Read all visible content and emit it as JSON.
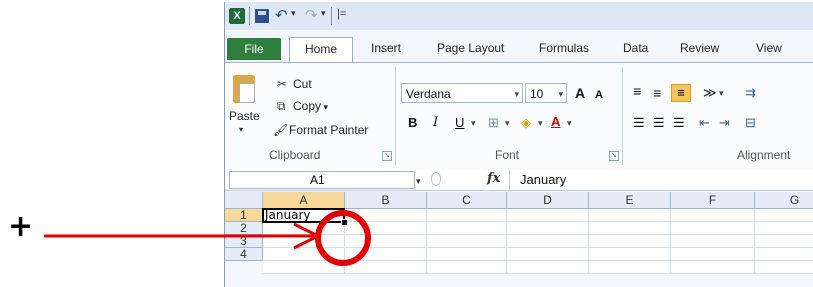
{
  "annotation": {
    "plus": "+",
    "arrow_color": "#e00000"
  },
  "qat": {
    "app_icon": "X",
    "undo_icon": "undo-icon",
    "redo_icon": "redo-icon",
    "more": "|="
  },
  "tabs": [
    "File",
    "Home",
    "Insert",
    "Page Layout",
    "Formulas",
    "Data",
    "Review",
    "View"
  ],
  "clipboard": {
    "paste": "Paste",
    "cut": "Cut",
    "copy": "Copy",
    "format_painter": "Format Painter",
    "label": "Clipboard"
  },
  "font": {
    "name": "Verdana",
    "size": "10",
    "label": "Font",
    "bold": "B",
    "italic": "I",
    "underline": "U",
    "grow": "A",
    "shrink": "A"
  },
  "alignment": {
    "label": "Alignment"
  },
  "formula_bar": {
    "name_box": "A1",
    "fx": "fx",
    "value": "January"
  },
  "grid": {
    "columns": [
      "A",
      "B",
      "C",
      "D",
      "E",
      "F",
      "G"
    ],
    "rows": [
      "1",
      "2",
      "3",
      "4"
    ],
    "cell_a1": "January"
  },
  "colors": {
    "accent_file_tab": "#2f7d3f",
    "selected_header": "#f9d99b"
  }
}
